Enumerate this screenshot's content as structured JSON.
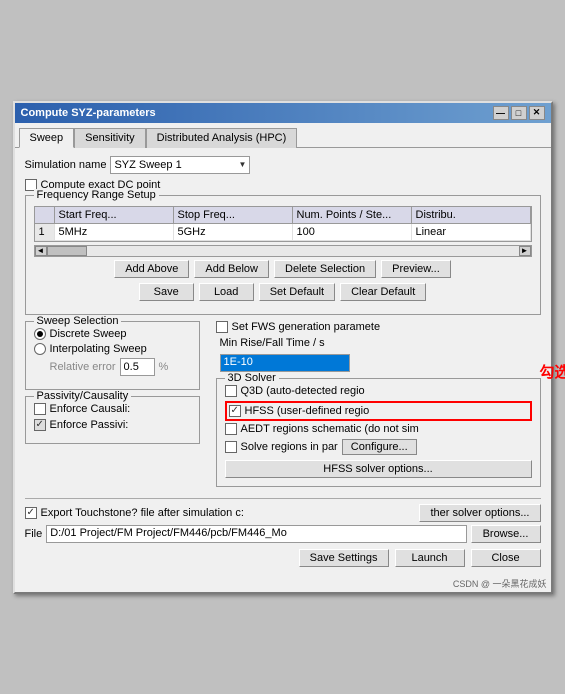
{
  "window": {
    "title": "Compute SYZ-parameters",
    "close_btn": "✕",
    "min_btn": "—",
    "max_btn": "□"
  },
  "tabs": [
    {
      "label": "Sweep",
      "active": true
    },
    {
      "label": "Sensitivity",
      "active": false
    },
    {
      "label": "Distributed Analysis (HPC)",
      "active": false
    }
  ],
  "simulation_name_label": "Simulation name",
  "simulation_name_value": "SYZ Sweep 1",
  "compute_exact_dc_label": "Compute exact DC point",
  "frequency_range_group": "Frequency Range Setup",
  "table": {
    "headers": [
      "",
      "Start Freq...",
      "Stop Freq...",
      "Num. Points / Ste...",
      "Distribu."
    ],
    "rows": [
      {
        "num": "1",
        "start": "5MHz",
        "stop": "5GHz",
        "points": "100",
        "dist": "Linear"
      }
    ]
  },
  "buttons": {
    "add_above": "Add Above",
    "add_below": "Add Below",
    "delete_selection": "Delete Selection",
    "preview": "Preview...",
    "save": "Save",
    "load": "Load",
    "set_default": "Set Default",
    "clear_default": "Clear Default"
  },
  "sweep_selection": {
    "label": "Sweep Selection",
    "discrete": "Discrete Sweep",
    "interpolating": "Interpolating Sweep",
    "relative_error_label": "Relative error",
    "relative_error_value": "0.5",
    "percent": "%"
  },
  "fws": {
    "label": "Set FWS generation paramete",
    "min_rise_label": "Min Rise/Fall Time / s",
    "min_rise_value": "1E-10"
  },
  "solver_3d": {
    "label": "3D Solver",
    "q3d": {
      "label": "Q3D (auto-detected regio",
      "checked": false
    },
    "hfss": {
      "label": "HFSS (user-defined regio",
      "checked": true
    },
    "aedt": {
      "label": "AEDT regions schematic (do not sim",
      "checked": false
    },
    "solve_regions": {
      "label": "Solve regions in par",
      "checked": false
    },
    "configure_btn": "Configure...",
    "solver_options_btn": "HFSS solver options..."
  },
  "passivity": {
    "label": "Passivity/Causality",
    "enforce_causality_label": "Enforce Causali:",
    "enforce_passivity_label": "Enforce Passivi:",
    "enforce_causality_checked": false,
    "enforce_passivity_checked": true
  },
  "export": {
    "label": "Export Touchstone? file after simulation c:",
    "checked": true,
    "file_label": "File",
    "file_value": "D:/01 Project/FM Project/FM446/pcb/FM446_Mo",
    "other_solver_btn": "ther solver options...",
    "browse_btn": "Browse..."
  },
  "footer": {
    "save_settings": "Save Settings",
    "launch": "Launch",
    "close": "Close"
  },
  "annotation": "勾选",
  "watermark": "CSDN @ 一朵黑花成妖"
}
